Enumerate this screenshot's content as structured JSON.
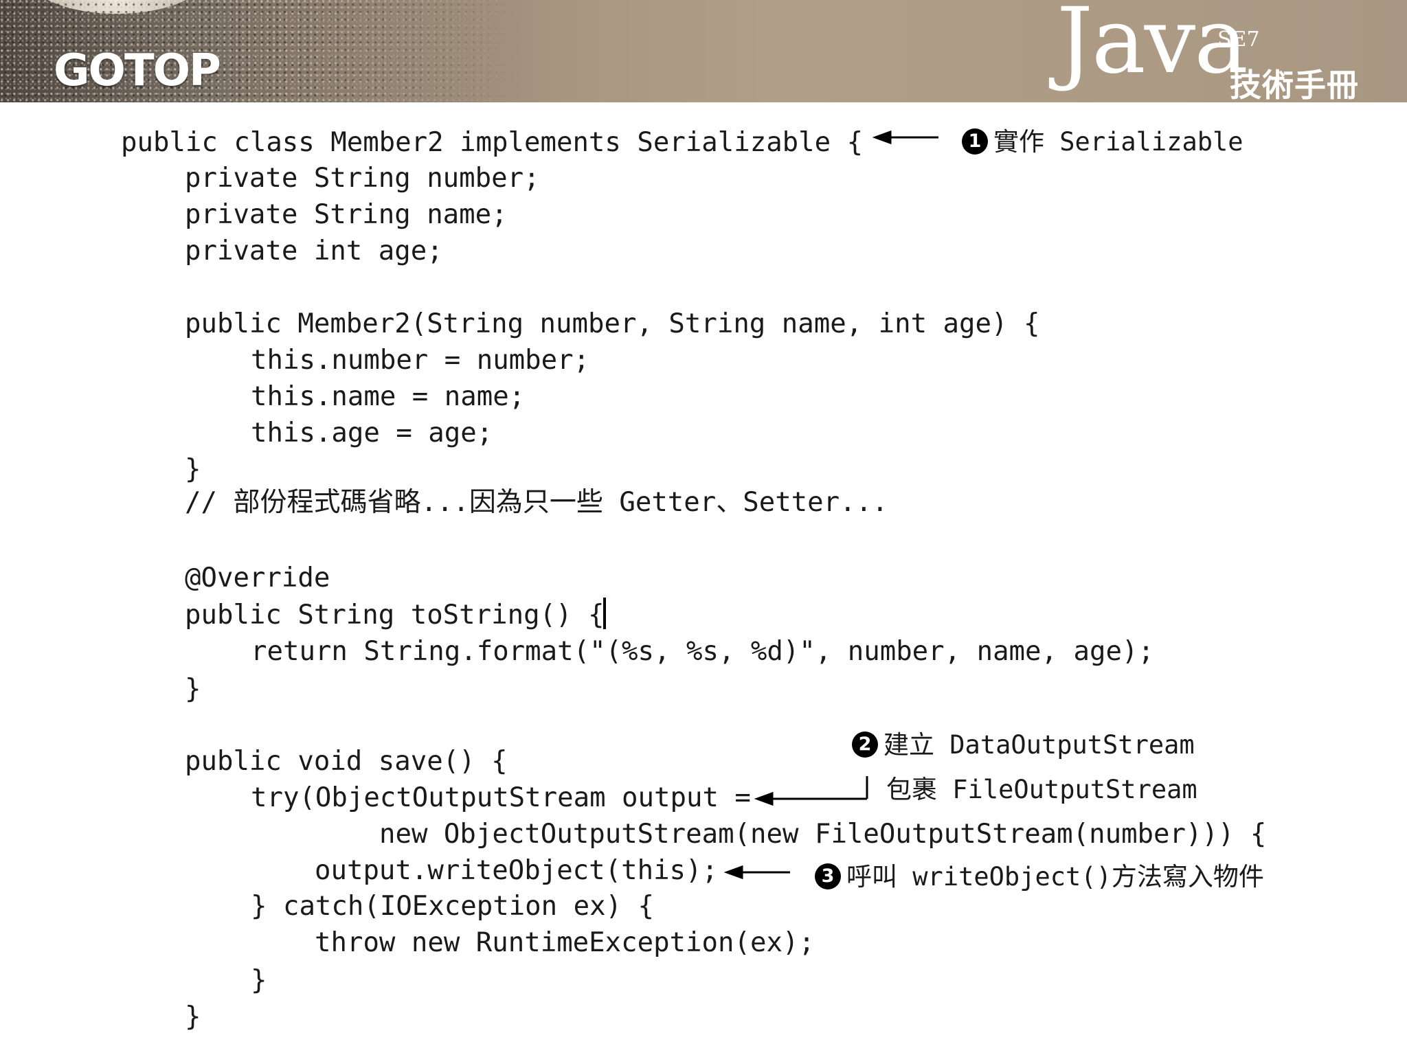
{
  "header": {
    "publisher_logo": "GOTOP",
    "book_title_main": "Java",
    "book_title_edition": "SE7",
    "book_title_sub": "技術手冊"
  },
  "code_lines": [
    "public class Member2 implements Serializable {",
    "private String number;",
    "private String name;",
    "private int age;",
    "public Member2(String number, String name, int age) {",
    "this.number = number;",
    "this.name = name;",
    "this.age = age;",
    "}",
    "// 部份程式碼省略...因為只一些 Getter、Setter...",
    "@Override",
    "public String toString() {",
    "return String.format(\"(%s, %s, %d)\", number, name, age);",
    "}",
    "public void save() {",
    "try(ObjectOutputStream output =",
    "new ObjectOutputStream(new FileOutputStream(number))) {",
    "output.writeObject(this);",
    "} catch(IOException ex) {",
    "throw new RuntimeException(ex);",
    "}",
    "}"
  ],
  "annotations": [
    {
      "badge": "1",
      "text": "實作 Serializable"
    },
    {
      "badge": "2",
      "text": "建立 DataOutputStream"
    },
    {
      "badge": "",
      "text": "包裹 FileOutputStream"
    },
    {
      "badge": "3",
      "text": "呼叫 writeObject()方法寫入物件"
    }
  ]
}
